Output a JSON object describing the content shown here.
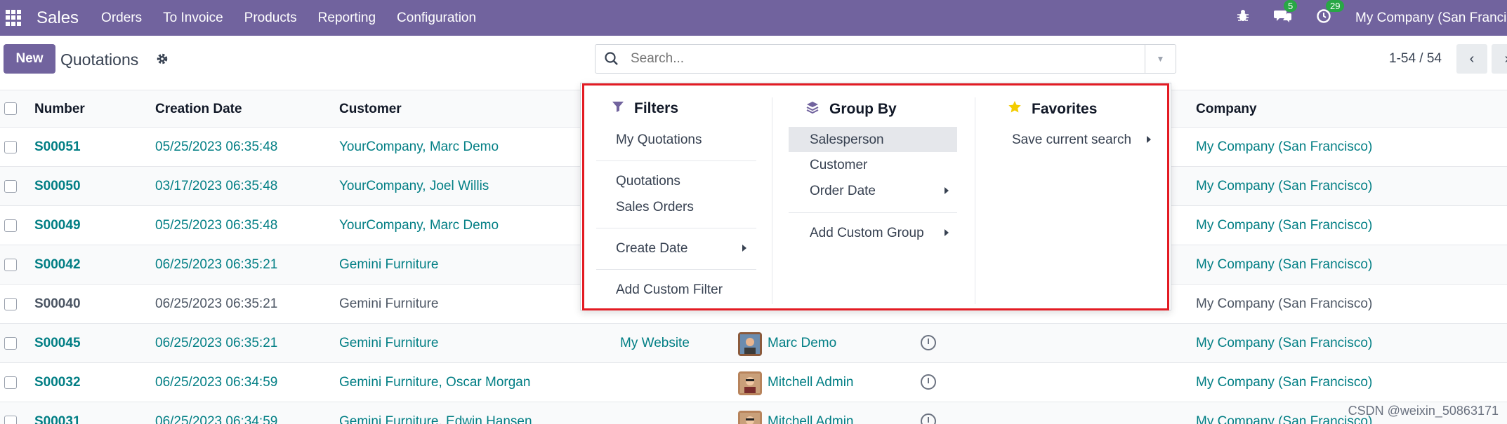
{
  "topnav": {
    "app_name": "Sales",
    "menu": [
      "Orders",
      "To Invoice",
      "Products",
      "Reporting",
      "Configuration"
    ],
    "messages_badge": "5",
    "activities_badge": "29",
    "company": "My Company (San Francisco)"
  },
  "control": {
    "new_label": "New",
    "breadcrumb": "Quotations",
    "search_placeholder": "Search...",
    "pager": "1-54 / 54"
  },
  "table": {
    "headers": {
      "number": "Number",
      "creation_date": "Creation Date",
      "customer": "Customer",
      "company": "Company"
    },
    "rows": [
      {
        "number": "S00051",
        "date": "05/25/2023 06:35:48",
        "customer": "YourCompany, Marc Demo",
        "website": "",
        "salesperson": "",
        "company": "My Company (San Francisco)"
      },
      {
        "number": "S00050",
        "date": "03/17/2023 06:35:48",
        "customer": "YourCompany, Joel Willis",
        "website": "",
        "salesperson": "",
        "company": "My Company (San Francisco)"
      },
      {
        "number": "S00049",
        "date": "05/25/2023 06:35:48",
        "customer": "YourCompany, Marc Demo",
        "website": "",
        "salesperson": "",
        "company": "My Company (San Francisco)"
      },
      {
        "number": "S00042",
        "date": "06/25/2023 06:35:21",
        "customer": "Gemini Furniture",
        "website": "",
        "salesperson": "",
        "company": "My Company (San Francisco)"
      },
      {
        "number": "S00040",
        "date": "06/25/2023 06:35:21",
        "customer": "Gemini Furniture",
        "website": "",
        "salesperson": "",
        "company": "My Company (San Francisco)"
      },
      {
        "number": "S00045",
        "date": "06/25/2023 06:35:21",
        "customer": "Gemini Furniture",
        "website": "My Website",
        "salesperson": "Marc Demo",
        "company": "My Company (San Francisco)"
      },
      {
        "number": "S00032",
        "date": "06/25/2023 06:34:59",
        "customer": "Gemini Furniture, Oscar Morgan",
        "website": "",
        "salesperson": "Mitchell Admin",
        "company": "My Company (San Francisco)"
      },
      {
        "number": "S00031",
        "date": "06/25/2023 06:34:59",
        "customer": "Gemini Furniture, Edwin Hansen",
        "website": "",
        "salesperson": "Mitchell Admin",
        "company": "My Company (San Francisco)"
      }
    ]
  },
  "dropdown": {
    "filters": {
      "title": "Filters",
      "items": [
        "My Quotations",
        "Quotations",
        "Sales Orders",
        "Create Date",
        "Add Custom Filter"
      ]
    },
    "group_by": {
      "title": "Group By",
      "items": [
        "Salesperson",
        "Customer",
        "Order Date",
        "Add Custom Group"
      ]
    },
    "favorites": {
      "title": "Favorites",
      "items": [
        "Save current search"
      ]
    }
  },
  "watermark": "CSDN @weixin_50863171",
  "colors": {
    "brand": "#71639e",
    "link": "#017e84",
    "highlight": "#e31b23"
  }
}
